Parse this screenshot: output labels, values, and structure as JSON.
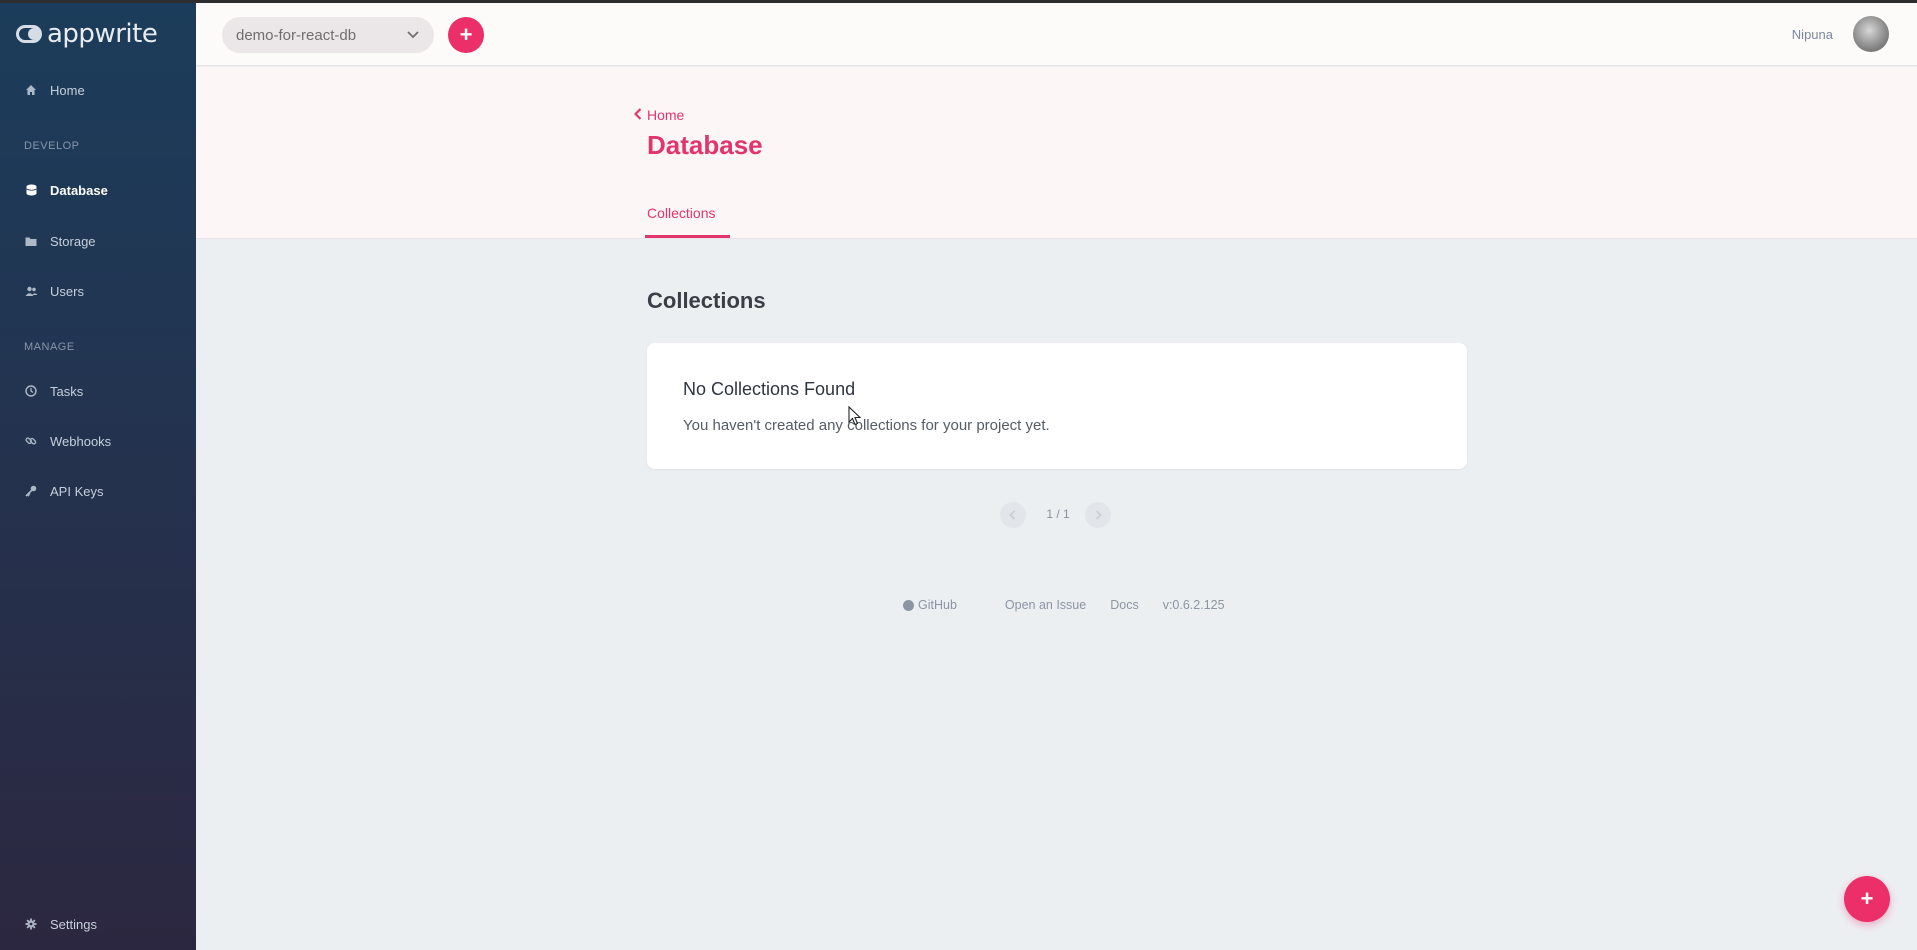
{
  "app": {
    "logo_text": "appwrite"
  },
  "sidebar": {
    "sections": [
      {
        "label": ""
      },
      {
        "label": "DEVELOP"
      },
      {
        "label": "MANAGE"
      }
    ],
    "items": [
      {
        "label": "Home",
        "icon": "home-icon"
      },
      {
        "label": "Database",
        "icon": "database-icon"
      },
      {
        "label": "Storage",
        "icon": "folder-icon"
      },
      {
        "label": "Users",
        "icon": "users-icon"
      },
      {
        "label": "Tasks",
        "icon": "clock-icon"
      },
      {
        "label": "Webhooks",
        "icon": "link-icon"
      },
      {
        "label": "API Keys",
        "icon": "key-icon"
      },
      {
        "label": "Settings",
        "icon": "gear-icon"
      }
    ]
  },
  "header": {
    "project_name": "demo-for-react-db",
    "username": "Nipuna"
  },
  "page": {
    "back_label": "Home",
    "title": "Database",
    "tabs": [
      {
        "label": "Collections",
        "active": true
      }
    ]
  },
  "main": {
    "section_title": "Collections",
    "empty_title": "No Collections Found",
    "empty_text": "You haven't created any collections for your project yet.",
    "pagination": "1 / 1"
  },
  "footer": {
    "github": "GitHub",
    "issue": "Open an Issue",
    "docs": "Docs",
    "version": "v:0.6.2.125"
  },
  "colors": {
    "accent": "#e1356c",
    "button": "#ec2f69",
    "sidebar_top": "#1b3d5b",
    "sidebar_bottom": "#2c2740",
    "background": "#eceff2"
  }
}
